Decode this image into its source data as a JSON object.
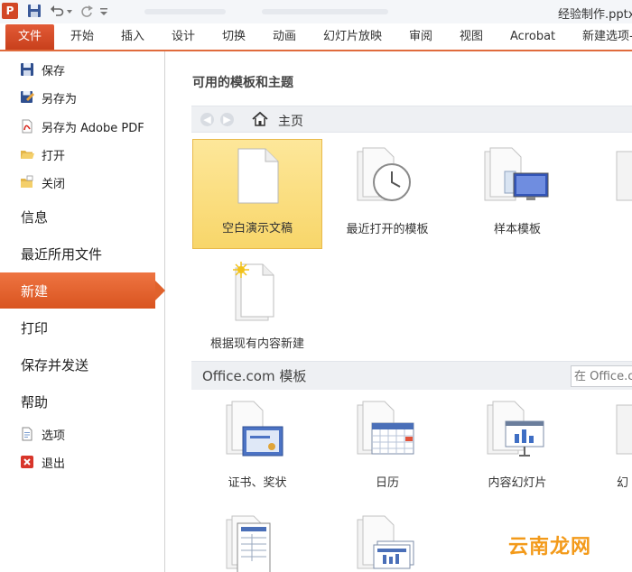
{
  "titlebar": {
    "app_logo": "P",
    "document_title": "经验制作.pptx"
  },
  "ribbon": {
    "file_tab": "文件",
    "tabs": [
      "开始",
      "插入",
      "设计",
      "切换",
      "动画",
      "幻灯片放映",
      "审阅",
      "视图",
      "Acrobat",
      "新建选项-"
    ]
  },
  "backstage_nav": {
    "small_items_top": [
      {
        "label": "保存",
        "icon": "floppy-save-icon"
      },
      {
        "label": "另存为",
        "icon": "save-as-icon"
      },
      {
        "label": "另存为 Adobe PDF",
        "icon": "pdf-save-icon"
      },
      {
        "label": "打开",
        "icon": "open-folder-icon"
      },
      {
        "label": "关闭",
        "icon": "close-folder-icon"
      }
    ],
    "big_items": [
      {
        "label": "信息",
        "active": false
      },
      {
        "label": "最近所用文件",
        "active": false
      },
      {
        "label": "新建",
        "active": true
      },
      {
        "label": "打印",
        "active": false
      },
      {
        "label": "保存并发送",
        "active": false
      },
      {
        "label": "帮助",
        "active": false
      }
    ],
    "small_items_bottom": [
      {
        "label": "选项",
        "icon": "options-icon"
      },
      {
        "label": "退出",
        "icon": "exit-icon"
      }
    ]
  },
  "main": {
    "section_title": "可用的模板和主题",
    "nav_home_label": "主页",
    "available_templates": [
      {
        "label": "空白演示文稿",
        "icon": "blank-document-icon",
        "selected": true
      },
      {
        "label": "最近打开的模板",
        "icon": "recent-templates-clock-icon",
        "selected": false
      },
      {
        "label": "样本模板",
        "icon": "sample-templates-icon",
        "selected": false
      },
      {
        "label": "根据现有内容新建",
        "icon": "new-from-existing-icon",
        "selected": false
      }
    ],
    "office_section_title": "Office.com 模板",
    "office_search_placeholder": "在 Office.c",
    "office_templates": [
      {
        "label": "证书、奖状",
        "icon": "certificate-icon"
      },
      {
        "label": "日历",
        "icon": "calendar-icon"
      },
      {
        "label": "内容幻灯片",
        "icon": "content-slides-icon"
      },
      {
        "label": "",
        "icon": "form-document-icon"
      },
      {
        "label": "",
        "icon": "presentation-stack-icon"
      }
    ]
  },
  "watermark": "云南龙网",
  "colors": {
    "accent_orange": "#e0622c",
    "selected_tile": "#f8d66a"
  }
}
